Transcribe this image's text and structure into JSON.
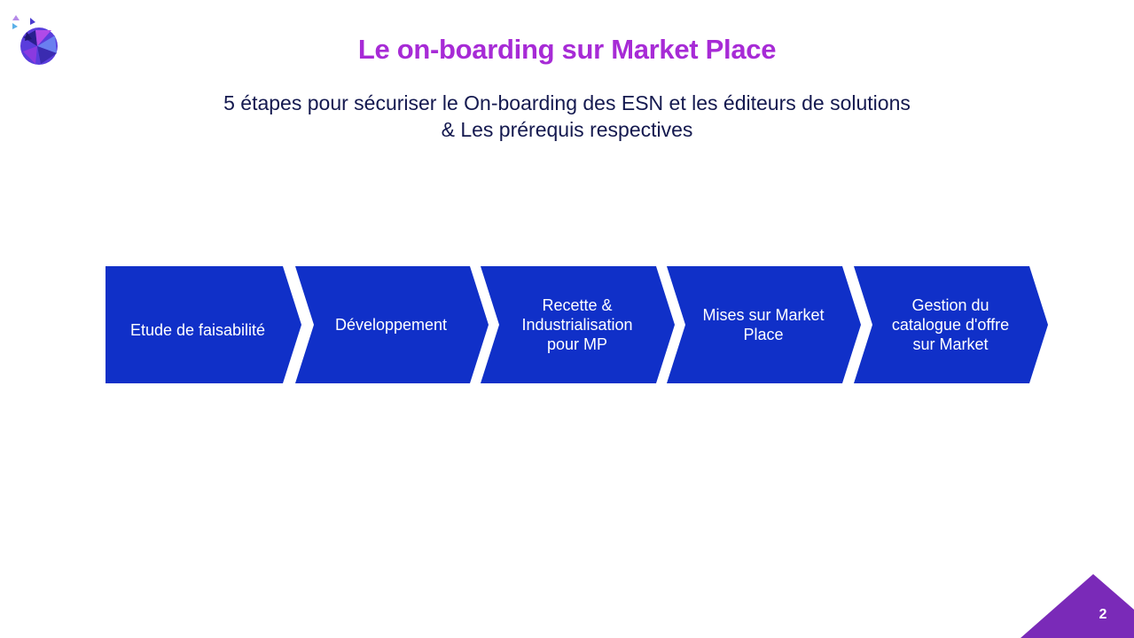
{
  "slide": {
    "title": "Le on-boarding sur Market Place",
    "subtitle_line1": "5 étapes pour sécuriser le On-boarding des ESN et les éditeurs de solutions",
    "subtitle_line2": "& Les prérequis respectives",
    "page_number": "2"
  },
  "steps": [
    {
      "label": "Etude de faisabilité"
    },
    {
      "label": "Développement"
    },
    {
      "label": "Recette & Industrialisation pour MP"
    },
    {
      "label": "Mises sur Market Place"
    },
    {
      "label": "Gestion du catalogue d'offre sur Market"
    }
  ],
  "colors": {
    "title": "#a72bd6",
    "subtitle": "#14194f",
    "chevron": "#1030c8",
    "corner": "#7a2ab8"
  }
}
